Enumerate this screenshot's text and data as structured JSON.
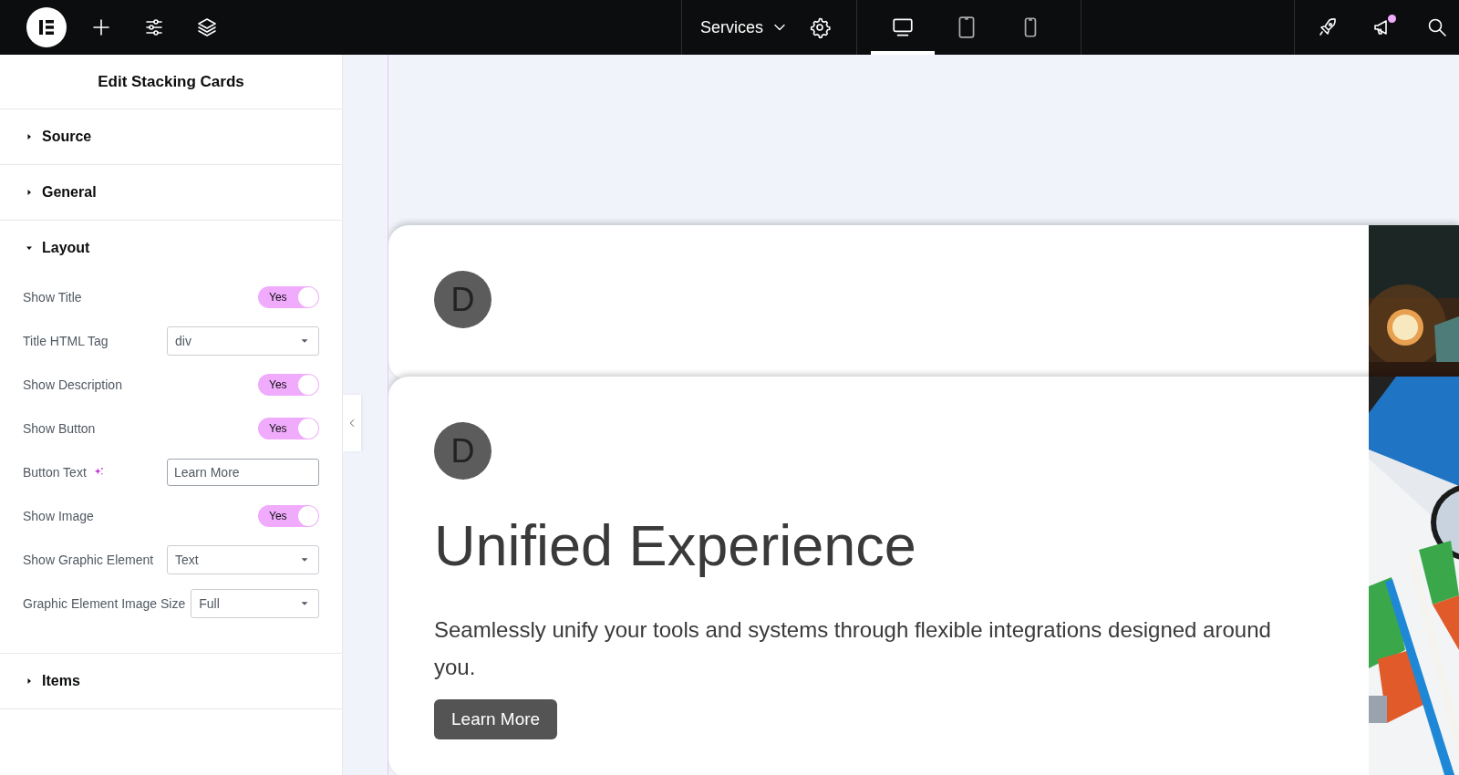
{
  "topbar": {
    "page_title": "Services",
    "devices": [
      {
        "kind": "desktop",
        "selected": true
      },
      {
        "kind": "tablet",
        "selected": false
      },
      {
        "kind": "mobile",
        "selected": false
      }
    ],
    "notification_dot": true
  },
  "panel": {
    "title": "Edit Stacking Cards",
    "sections": [
      {
        "label": "Source",
        "expanded": false
      },
      {
        "label": "General",
        "expanded": false
      },
      {
        "label": "Layout",
        "expanded": true,
        "controls": [
          {
            "kind": "toggle",
            "label": "Show Title",
            "on": true,
            "value": "Yes"
          },
          {
            "kind": "select",
            "label": "Title HTML Tag",
            "value": "div"
          },
          {
            "kind": "toggle",
            "label": "Show Description",
            "on": true,
            "value": "Yes"
          },
          {
            "kind": "toggle",
            "label": "Show Button",
            "on": true,
            "value": "Yes"
          },
          {
            "kind": "text",
            "label": "Button Text",
            "ai": true,
            "value": "Learn More"
          },
          {
            "kind": "toggle",
            "label": "Show Image",
            "on": true,
            "value": "Yes"
          },
          {
            "kind": "select",
            "label": "Show Graphic Element",
            "value": "Text"
          },
          {
            "kind": "select",
            "label": "Graphic Element Image Size",
            "value": "Full"
          }
        ]
      },
      {
        "label": "Items",
        "expanded": false
      }
    ]
  },
  "canvas": {
    "cards": [
      {
        "badge": "D"
      },
      {
        "badge": "D",
        "title": "Unified Experience",
        "description": "Seamlessly unify your tools and systems through flexible integrations designed around you.",
        "button": "Learn More"
      }
    ]
  }
}
